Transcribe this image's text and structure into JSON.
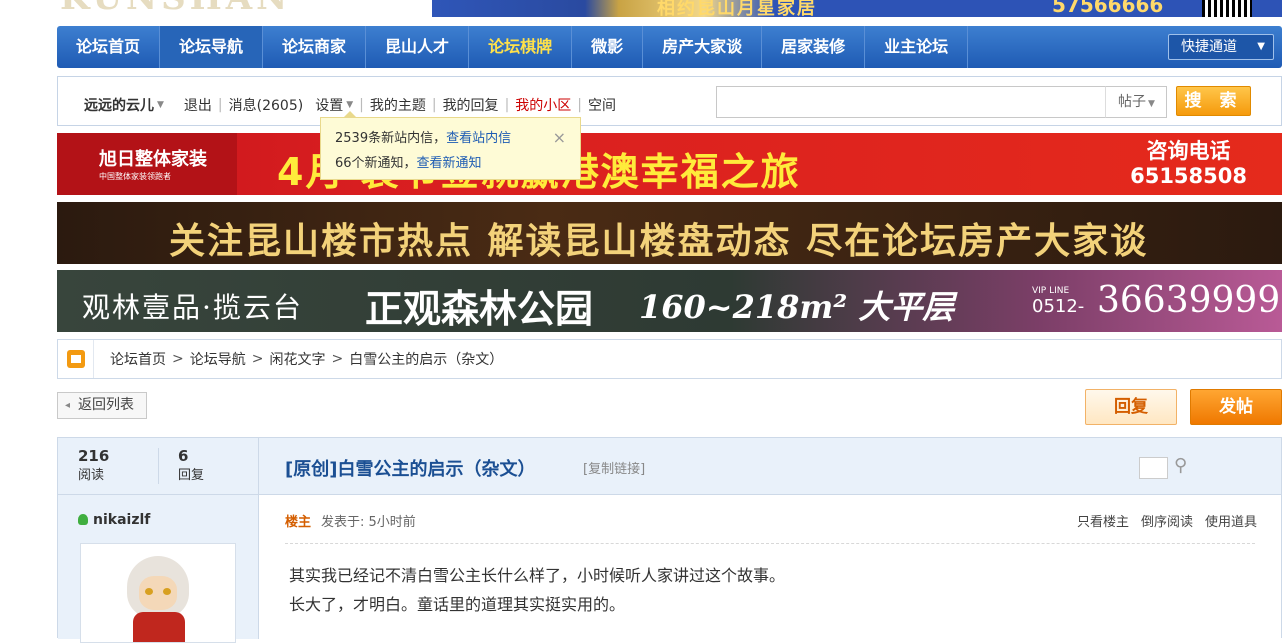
{
  "top": {
    "logo_text": "KUNSHAN BBS",
    "ad_text": "相约昆山月星家居",
    "ad_number": "57566666"
  },
  "nav": {
    "items": [
      {
        "label": "论坛首页"
      },
      {
        "label": "论坛导航"
      },
      {
        "label": "论坛商家"
      },
      {
        "label": "昆山人才"
      },
      {
        "label": "论坛棋牌"
      },
      {
        "label": "微影"
      },
      {
        "label": "房产大家谈"
      },
      {
        "label": "居家装修"
      },
      {
        "label": "业主论坛"
      }
    ],
    "quick_access": "快捷通道"
  },
  "userbar": {
    "username": "远远的云儿",
    "logout": "退出",
    "messages": "消息(2605)",
    "settings": "设置",
    "my_threads": "我的主题",
    "my_replies": "我的回复",
    "my_community": "我的小区",
    "space": "空间",
    "search_placeholder": "",
    "search_type": "帖子",
    "search_button": "搜 索"
  },
  "popup": {
    "line1_text": "2539条新站内信，",
    "line1_link": "查看站内信",
    "line2_text": "66个新通知，",
    "line2_link": "查看新通知",
    "close": "×"
  },
  "banners": {
    "b1_logo": "旭日整体家装",
    "b1_logo_sub": "中国整体家装领跑者",
    "b1_main": "4月   装节签就赢港澳幸福之旅",
    "b1_tel_label": "咨询电话",
    "b1_tel": "65158508",
    "b2_text": "关注昆山楼市热点  解读昆山楼盘动态  尽在论坛房产大家谈",
    "b3_t1": "观林壹品·揽云台",
    "b3_t2": "正观森林公园",
    "b3_t3": "160~218m² 大平层",
    "b3_vip": "VIP LINE",
    "b3_area": "0512-",
    "b3_tel": "36639999"
  },
  "breadcrumb": {
    "items": [
      "论坛首页",
      "论坛导航",
      "闲花文字",
      "白雪公主的启示（杂文）"
    ]
  },
  "actions": {
    "back": "返回列表",
    "reply": "回复",
    "post": "发帖"
  },
  "thread": {
    "reads": "216",
    "reads_label": "阅读",
    "replies": "6",
    "replies_label": "回复",
    "title": "[原创]白雪公主的启示（杂文）",
    "copy_link": "[复制链接]"
  },
  "post": {
    "author": "nikaizlf",
    "owner_label": "楼主",
    "posted": "发表于: 5小时前",
    "tools": [
      "只看楼主",
      "倒序阅读",
      "使用道具"
    ],
    "lines": [
      "其实我已经记不清白雪公主长什么样了，小时候听人家讲过这个故事。",
      "长大了，才明白。童话里的道理其实挺实用的。"
    ]
  }
}
